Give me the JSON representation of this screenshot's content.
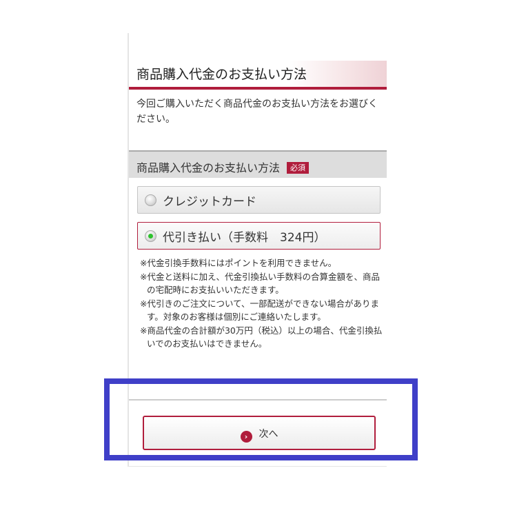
{
  "page": {
    "title": "商品購入代金のお支払い方法",
    "intro": "今回ご購入いただく商品代金のお支払い方法をお選びください。"
  },
  "payment": {
    "section_title": "商品購入代金のお支払い方法",
    "required_badge": "必須",
    "options": [
      {
        "label": "クレジットカード",
        "selected": false
      },
      {
        "label": "代引き払い（手数料　324円）",
        "selected": true
      }
    ],
    "notes": [
      "※代金引換手数料にはポイントを利用できません。",
      "※代金と送料に加え、代金引換払い手数料の合算金額を、商品の宅配時にお支払いいただきます。",
      "※代引きのご注文について、一部配送ができない場合があります。対象のお客様は個別にご連絡いたします。",
      "※商品代金の合計額が30万円（税込）以上の場合、代金引換払いでのお支払いはできません。"
    ]
  },
  "actions": {
    "next_label": "次へ",
    "next_icon": "chevron-right-icon"
  },
  "colors": {
    "accent": "#b01d3c",
    "radio_selected": "#2ec12e",
    "highlight": "#3f3fc8"
  }
}
